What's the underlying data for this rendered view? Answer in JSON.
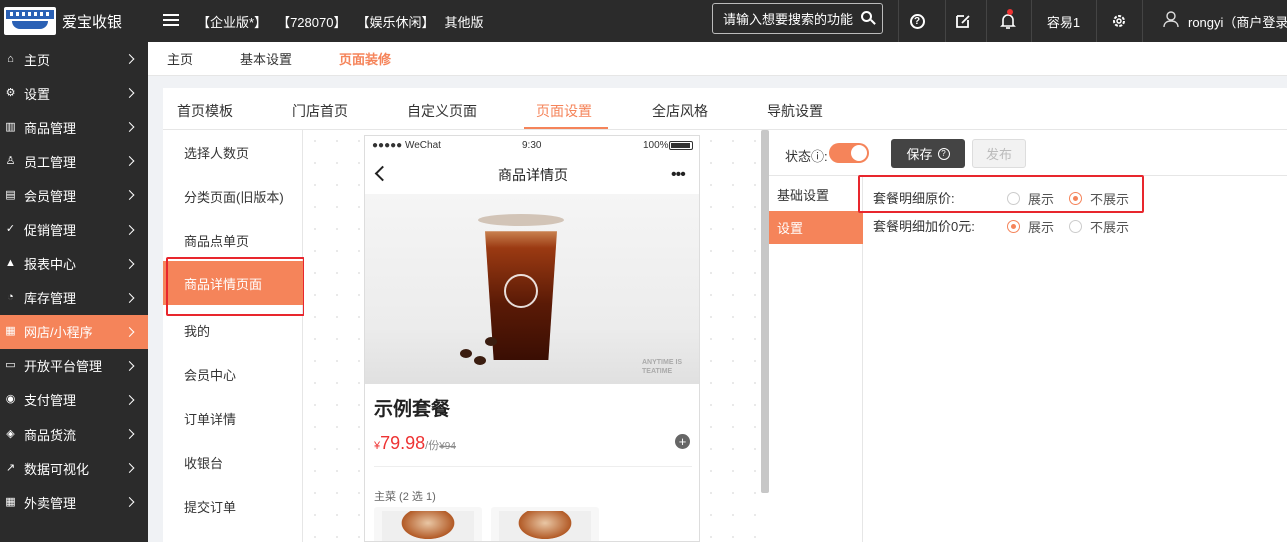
{
  "app": {
    "logo_text": "爱宝收银",
    "top_links": [
      "【企业版*】",
      "【728070】",
      "【娱乐休闲】",
      "其他版"
    ],
    "search_placeholder": "请输入想要搜索的功能",
    "user_label": "容易1",
    "user_name": "rongyi（商户登录"
  },
  "sidebar": {
    "items": [
      {
        "label": "主页",
        "icon": "home-icon",
        "glyph": "⌂"
      },
      {
        "label": "设置",
        "icon": "gear-icon",
        "glyph": "⚙"
      },
      {
        "label": "商品管理",
        "icon": "barcode-icon",
        "glyph": "▥"
      },
      {
        "label": "员工管理",
        "icon": "staff-icon",
        "glyph": "♙"
      },
      {
        "label": "会员管理",
        "icon": "member-card-icon",
        "glyph": "▤"
      },
      {
        "label": "促销管理",
        "icon": "check-circle-icon",
        "glyph": "✓"
      },
      {
        "label": "报表中心",
        "icon": "chart-icon",
        "glyph": "▲"
      },
      {
        "label": "库存管理",
        "icon": "pie-icon",
        "glyph": "◔"
      },
      {
        "label": "网店/小程序",
        "icon": "store-icon",
        "glyph": "▦"
      },
      {
        "label": "开放平台管理",
        "icon": "monitor-icon",
        "glyph": "▭"
      },
      {
        "label": "支付管理",
        "icon": "payment-icon",
        "glyph": "◉"
      },
      {
        "label": "商品货流",
        "icon": "cube-icon",
        "glyph": "◈"
      },
      {
        "label": "数据可视化",
        "icon": "line-chart-icon",
        "glyph": "↗"
      },
      {
        "label": "外卖管理",
        "icon": "takeout-icon",
        "glyph": "▦"
      }
    ],
    "active_index": 8
  },
  "breadcrumb": [
    "主页",
    "基本设置",
    "页面装修"
  ],
  "tabs": [
    "首页模板",
    "门店首页",
    "自定义页面",
    "页面设置",
    "全店风格",
    "导航设置"
  ],
  "active_tab": "页面设置",
  "page_list": [
    "选择人数页",
    "分类页面(旧版本)",
    "商品点单页",
    "商品详情页面",
    "我的",
    "会员中心",
    "订单详情",
    "收银台",
    "提交订单"
  ],
  "active_page": "商品详情页面",
  "phone": {
    "carrier": "●●●●● WeChat",
    "time": "9:30",
    "battery": "100%",
    "nav_title": "商品详情页",
    "more": "•••",
    "img_caption_1": "ANYTIME IS",
    "img_caption_2": "TEATIME",
    "product_name": "示例套餐",
    "price_symbol": "¥",
    "price": "79.98",
    "unit": "/份",
    "old_price": "¥94",
    "add_btn": "+",
    "group_label": "主菜 (2 选 1)"
  },
  "settings": {
    "status_label": "状态",
    "status_on": true,
    "save_label": "保存",
    "publish_label": "发布",
    "nav": [
      "基础设置",
      "设置"
    ],
    "active_nav": "设置",
    "options": [
      {
        "label": "套餐明细原价:",
        "choices": [
          "展示",
          "不展示"
        ],
        "selected": "不展示"
      },
      {
        "label": "套餐明细加价0元:",
        "choices": [
          "展示",
          "不展示"
        ],
        "selected": "展示"
      }
    ]
  },
  "colors": {
    "accent": "#f5845a",
    "topbar": "#2b2b2b",
    "highlight_box": "#e8262d",
    "price": "#e33333"
  }
}
